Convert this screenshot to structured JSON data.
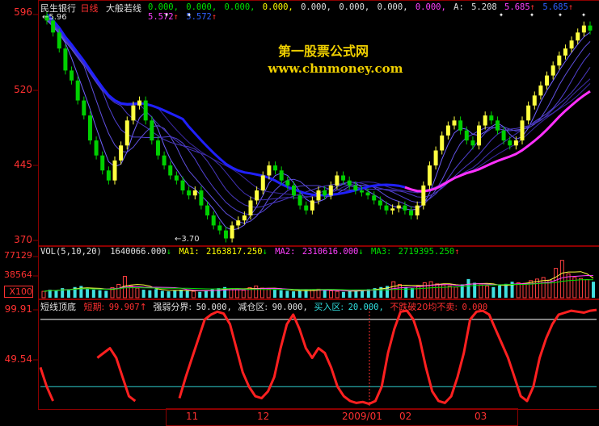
{
  "header": {
    "stock_name": "民生银行",
    "period": "日线",
    "indicator_name": "大般若线",
    "indicator_values": [
      "0.000,",
      "0.000,",
      "0.000,",
      "0.000,",
      "0.000,",
      "0.000,",
      "0.000,",
      "0.000,"
    ],
    "a_label": "A:",
    "a_value": "5.208",
    "extra_values": [
      "5.685",
      "5.685",
      "5.572",
      "5.572"
    ],
    "arrow_up": "↑"
  },
  "watermark": {
    "line1": "第一股票公式网",
    "line2": "www.chnmoney.com"
  },
  "price_axis": {
    "ticks": [
      "596",
      "520",
      "445",
      "370"
    ],
    "high_marker": "5.96",
    "low_marker": "3.70"
  },
  "volume_panel": {
    "header_label": "VOL(5,10,20)",
    "vol_value": "1640066.000",
    "ma1_label": "MA1:",
    "ma1_value": "2163817.250",
    "ma2_label": "MA2:",
    "ma2_value": "2310616.000",
    "ma3_label": "MA3:",
    "ma3_value": "2719395.250",
    "down_arrow": "↓",
    "up_arrow": "↑",
    "ticks": [
      "77129",
      "38564",
      "X100"
    ]
  },
  "oscillator_panel": {
    "name": "短线顶底",
    "period_label": "短期:",
    "period_value": "99.907",
    "strength_label": "强弱分界:",
    "strength_value": "50.000,",
    "reduce_label": "减仓区:",
    "reduce_value": "90.000,",
    "buy_label": "买入区:",
    "buy_value": "20.000,",
    "warn_label": "不跌破20均不卖:",
    "warn_value": "0.000",
    "ticks": [
      "99.91",
      "49.54"
    ]
  },
  "x_axis": {
    "ticks": [
      "11",
      "12",
      "2009/01",
      "02",
      "03"
    ]
  },
  "chart_data": [
    {
      "type": "line",
      "title": "大般若线",
      "ylim": [
        3.7,
        5.96
      ],
      "y_ticks": [
        5.96,
        5.2,
        4.45,
        3.7
      ],
      "series": [
        {
          "name": "close",
          "values": [
            5.9,
            5.78,
            5.62,
            5.4,
            5.3,
            5.1,
            4.95,
            4.7,
            4.55,
            4.4,
            4.3,
            4.5,
            4.65,
            4.9,
            5.05,
            5.1,
            4.9,
            4.7,
            4.55,
            4.45,
            4.35,
            4.3,
            4.2,
            4.15,
            4.2,
            4.05,
            3.95,
            3.85,
            3.8,
            3.72,
            3.85,
            3.9,
            3.95,
            4.1,
            4.2,
            4.35,
            4.45,
            4.4,
            4.3,
            4.25,
            4.15,
            4.05,
            4.0,
            4.1,
            4.2,
            4.15,
            4.25,
            4.35,
            4.3,
            4.25,
            4.2,
            4.18,
            4.15,
            4.1,
            4.05,
            4.0,
            4.02,
            4.05,
            4.0,
            3.95,
            4.05,
            4.25,
            4.45,
            4.6,
            4.75,
            4.85,
            4.9,
            4.8,
            4.7,
            4.65,
            4.85,
            4.95,
            4.9,
            4.8,
            4.7,
            4.65,
            4.7,
            4.9,
            5.05,
            5.15,
            5.25,
            5.35,
            5.45,
            5.55,
            5.62,
            5.7,
            5.78,
            5.85,
            5.8
          ]
        }
      ]
    },
    {
      "type": "bar",
      "title": "VOL(5,10,20)",
      "ylim": [
        0,
        77129
      ],
      "series": [
        {
          "name": "VOL",
          "values": [
            12000,
            15000,
            14000,
            18000,
            16000,
            20000,
            22000,
            17000,
            15000,
            14000,
            13000,
            19000,
            25000,
            40000,
            22000,
            18000,
            15000,
            14000,
            16000,
            13000,
            12000,
            14000,
            15000,
            13000,
            12000,
            11000,
            14000,
            16000,
            18000,
            20000,
            17000,
            15000,
            14000,
            19000,
            22000,
            18000,
            16000,
            15000,
            14000,
            13000,
            12000,
            13000,
            14000,
            15000,
            16000,
            14000,
            13000,
            12000,
            11000,
            13000,
            14000,
            15000,
            16000,
            18000,
            20000,
            22000,
            30000,
            25000,
            20000,
            18000,
            22000,
            28000,
            30000,
            26000,
            24000,
            22000,
            20000,
            25000,
            35000,
            28000,
            24000,
            22000,
            20000,
            23000,
            26000,
            30000,
            28000,
            27000,
            32000,
            35000,
            38000,
            33000,
            55000,
            70000,
            45000,
            38000,
            36000,
            34000,
            30000
          ]
        }
      ]
    },
    {
      "type": "line",
      "title": "短线顶底",
      "ylim": [
        0,
        105
      ],
      "y_ticks": [
        99.91,
        49.54
      ],
      "series": [
        {
          "name": "短期",
          "values": [
            40,
            20,
            5,
            null,
            null,
            null,
            null,
            null,
            null,
            50,
            55,
            60,
            50,
            30,
            10,
            5,
            null,
            3,
            null,
            null,
            null,
            null,
            8,
            30,
            50,
            70,
            90,
            95,
            98,
            96,
            85,
            60,
            35,
            20,
            10,
            8,
            15,
            30,
            60,
            85,
            95,
            80,
            60,
            50,
            60,
            55,
            40,
            20,
            10,
            5,
            3,
            4,
            2,
            5,
            20,
            55,
            80,
            98,
            99,
            90,
            70,
            40,
            15,
            5,
            3,
            10,
            30,
            55,
            90,
            98,
            99,
            95,
            80,
            65,
            50,
            30,
            10,
            5,
            20,
            50,
            70,
            85,
            95,
            97,
            99,
            98,
            97,
            99,
            99.9
          ]
        }
      ]
    }
  ]
}
